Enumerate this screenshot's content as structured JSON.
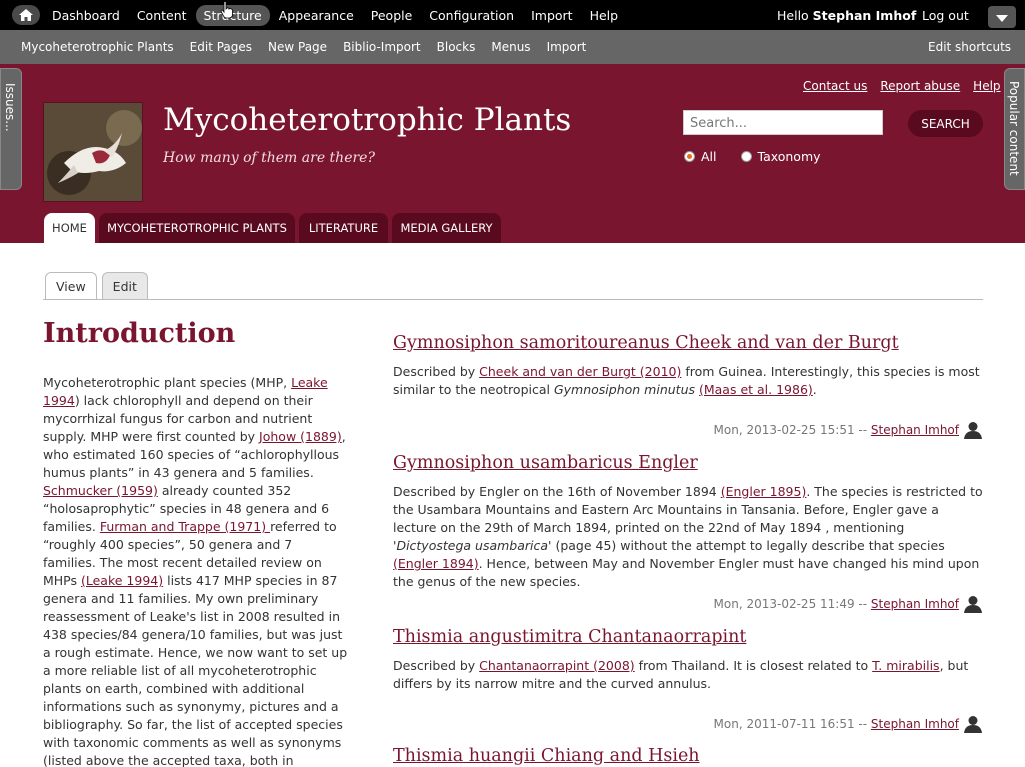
{
  "admin_menu": {
    "items": [
      "Dashboard",
      "Content",
      "Structure",
      "Appearance",
      "People",
      "Configuration",
      "Import",
      "Help"
    ],
    "hello_prefix": "Hello ",
    "user_name": "Stephan Imhof",
    "logout_label": "Log out"
  },
  "shortcuts": {
    "items": [
      "Mycoheterotrophic Plants",
      "Edit Pages",
      "New Page",
      "Biblio-Import",
      "Blocks",
      "Menus",
      "Import"
    ],
    "edit_label": "Edit shortcuts"
  },
  "side_tabs": {
    "left": "Issues...",
    "right": "Popular content"
  },
  "site": {
    "name": "Mycoheterotrophic Plants",
    "slogan": "How many of them are there?"
  },
  "secondary_links": [
    "Contact us",
    "Report abuse",
    "Help"
  ],
  "search": {
    "placeholder": "Search...",
    "button_label": "SEARCH",
    "options": [
      "All",
      "Taxonomy"
    ],
    "selected": "All"
  },
  "main_tabs": [
    "HOME",
    "MYCOHETEROTROPHIC PLANTS",
    "LITERATURE",
    "MEDIA GALLERY"
  ],
  "content_tabs": [
    "View",
    "Edit"
  ],
  "intro": {
    "title": "Introduction",
    "p1": "Mycoheterotrophic plant species (MHP, ",
    "link1": "Leake 1994",
    "p2": ") lack chlorophyll and depend on their mycorrhizal fungus for carbon and nutrient supply. MHP were first counted by ",
    "link2": "Johow (1889)",
    "p3": ", who estimated 160 species of “achlorophyllous humus plants” in 43 genera and 5 families. ",
    "link3": "Schmucker (1959)",
    "p4": " already counted 352 “holosaprophytic” species in 48 genera and 6 families. ",
    "link4": "Furman and Trappe (1971) ",
    "p5": "referred to “roughly 400 species”, 50 genera and 7 families. The most recent detailed review on MHPs ",
    "link5": "(Leake 1994)",
    "p6": " lists 417 MHP species in 87 genera and 11 families. My own preliminary reassessment of Leake's list in 2008 resulted in 438 species/84 genera/10 families, but was just a rough estimate. Hence, we now want to set up a more reliable list of all mycoheterotrophic plants on earth, combined with additional informations such as synonymy, pictures and a bibliography. So far, the list of accepted species with taxonomic comments as well as synonyms (listed above the accepted taxa, both in alphabetic order) are"
  },
  "nodes": [
    {
      "title": "Gymnosiphon samoritoureanus Cheek and van der Burgt",
      "t1": "Described by ",
      "l1": "Cheek and van der Burgt (2010)",
      "t2": " from Guinea. Interestingly, this species is most similar  to the neotropical ",
      "em": "Gymnosiphon minutus",
      "t3": " ",
      "l2": "(Maas et al. 1986)",
      "t4": ".",
      "date": "Mon, 2013-02-25 15:51 -- ",
      "author": "Stephan Imhof"
    },
    {
      "title": "Gymnosiphon usambaricus Engler",
      "t1": "Described by Engler on the 16th of November 1894 ",
      "l1": "(Engler 1895)",
      "t2": ". The species is restricted to the Usambara Mountains and Eastern Arc Mountains in Tansania. Before, Engler gave a lecture on the 29th of March 1894, printed on the 22nd of May 1894 , mentioning '",
      "em": "Dictyostega usambarica",
      "t3": "' (page 45) without the attempt to legally describe that species ",
      "l2": "(Engler 1894)",
      "t4": ". Hence, between May and November Engler must have changed his mind upon the genus of the new species.",
      "date": "Mon, 2013-02-25 11:49 -- ",
      "author": "Stephan Imhof"
    },
    {
      "title": "Thismia angustimitra Chantanaorrapint",
      "t1": "Described by ",
      "l1": "Chantanaorrapint (2008)",
      "t2": " from Thailand. It is closest related to ",
      "l2": "T. mirabilis",
      "t3": ", but differs by its narrow mitre and the curved annulus.",
      "date": "Mon, 2011-07-11 16:51 -- ",
      "author": "Stephan Imhof"
    },
    {
      "title": "Thismia huangii Chiang and Hsieh"
    }
  ],
  "icons": {
    "home": "home-icon",
    "toggle": "chevron-down-icon",
    "user": "user-icon",
    "cursor": "hand-cursor-icon"
  },
  "colors": {
    "brand": "#7a1530",
    "brand_dark": "#5a0a1f",
    "radio_selected": "#e07020"
  }
}
